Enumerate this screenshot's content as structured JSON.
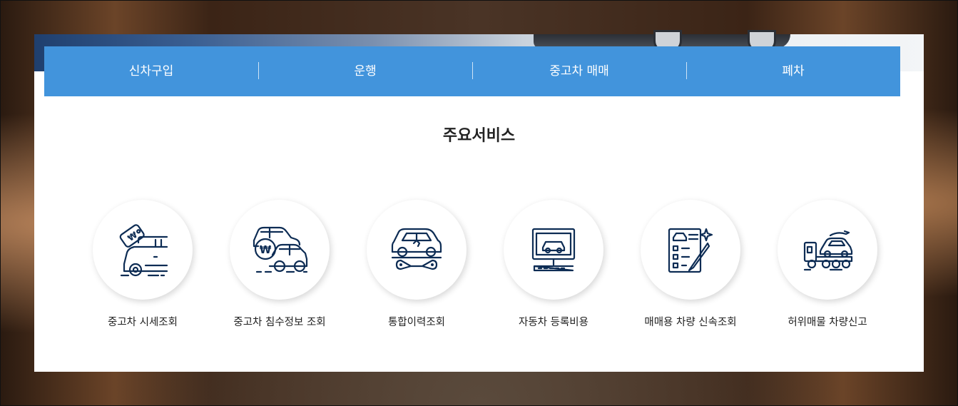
{
  "nav": {
    "items": [
      {
        "label": "신차구입"
      },
      {
        "label": "운행"
      },
      {
        "label": "중고차 매매"
      },
      {
        "label": "폐차"
      }
    ]
  },
  "main": {
    "title": "주요서비스",
    "services": [
      {
        "label": "중고차 시세조회",
        "icon": "car-price-tag-icon"
      },
      {
        "label": "중고차 침수정보 조회",
        "icon": "car-won-icon"
      },
      {
        "label": "통합이력조회",
        "icon": "car-repair-icon"
      },
      {
        "label": "자동차 등록비용",
        "icon": "car-monitor-icon"
      },
      {
        "label": "매매용 차량 신속조회",
        "icon": "car-checklist-icon"
      },
      {
        "label": "허위매물 차량신고",
        "icon": "tow-truck-icon"
      }
    ],
    "won_symbol": "₩"
  },
  "colors": {
    "nav_background": "#4294dc",
    "icon_stroke": "#0d2c54",
    "panel_background": "#ffffff"
  }
}
